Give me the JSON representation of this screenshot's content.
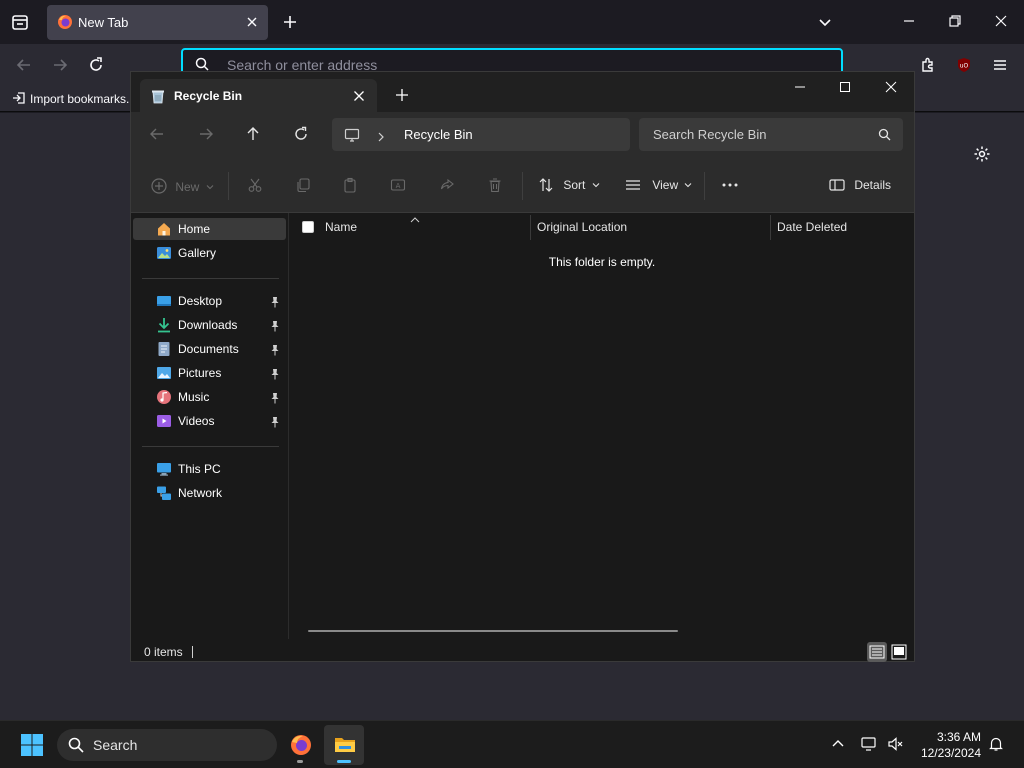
{
  "firefox": {
    "tab_title": "New Tab",
    "url_placeholder": "Search or enter address",
    "bookmark_import": "Import bookmarks...",
    "accent_color": "#00ddff"
  },
  "explorer": {
    "tab_title": "Recycle Bin",
    "breadcrumb": "Recycle Bin",
    "search_placeholder": "Search Recycle Bin",
    "toolbar": {
      "new_label": "New",
      "sort_label": "Sort",
      "view_label": "View",
      "details_label": "Details"
    },
    "sidebar": {
      "items": [
        {
          "label": "Home",
          "icon": "home-icon"
        },
        {
          "label": "Gallery",
          "icon": "gallery-icon"
        },
        {
          "label": "Desktop",
          "icon": "desktop-icon",
          "pinned": true
        },
        {
          "label": "Downloads",
          "icon": "download-icon",
          "pinned": true
        },
        {
          "label": "Documents",
          "icon": "documents-icon",
          "pinned": true
        },
        {
          "label": "Pictures",
          "icon": "pictures-icon",
          "pinned": true
        },
        {
          "label": "Music",
          "icon": "music-icon",
          "pinned": true
        },
        {
          "label": "Videos",
          "icon": "videos-icon",
          "pinned": true
        },
        {
          "label": "This PC",
          "icon": "this-pc-icon"
        },
        {
          "label": "Network",
          "icon": "network-icon"
        }
      ]
    },
    "columns": [
      "Name",
      "Original Location",
      "Date Deleted"
    ],
    "empty_message": "This folder is empty.",
    "status": {
      "item_count": "0 items"
    }
  },
  "taskbar": {
    "search_placeholder": "Search",
    "time": "3:36 AM",
    "date": "12/23/2024"
  }
}
